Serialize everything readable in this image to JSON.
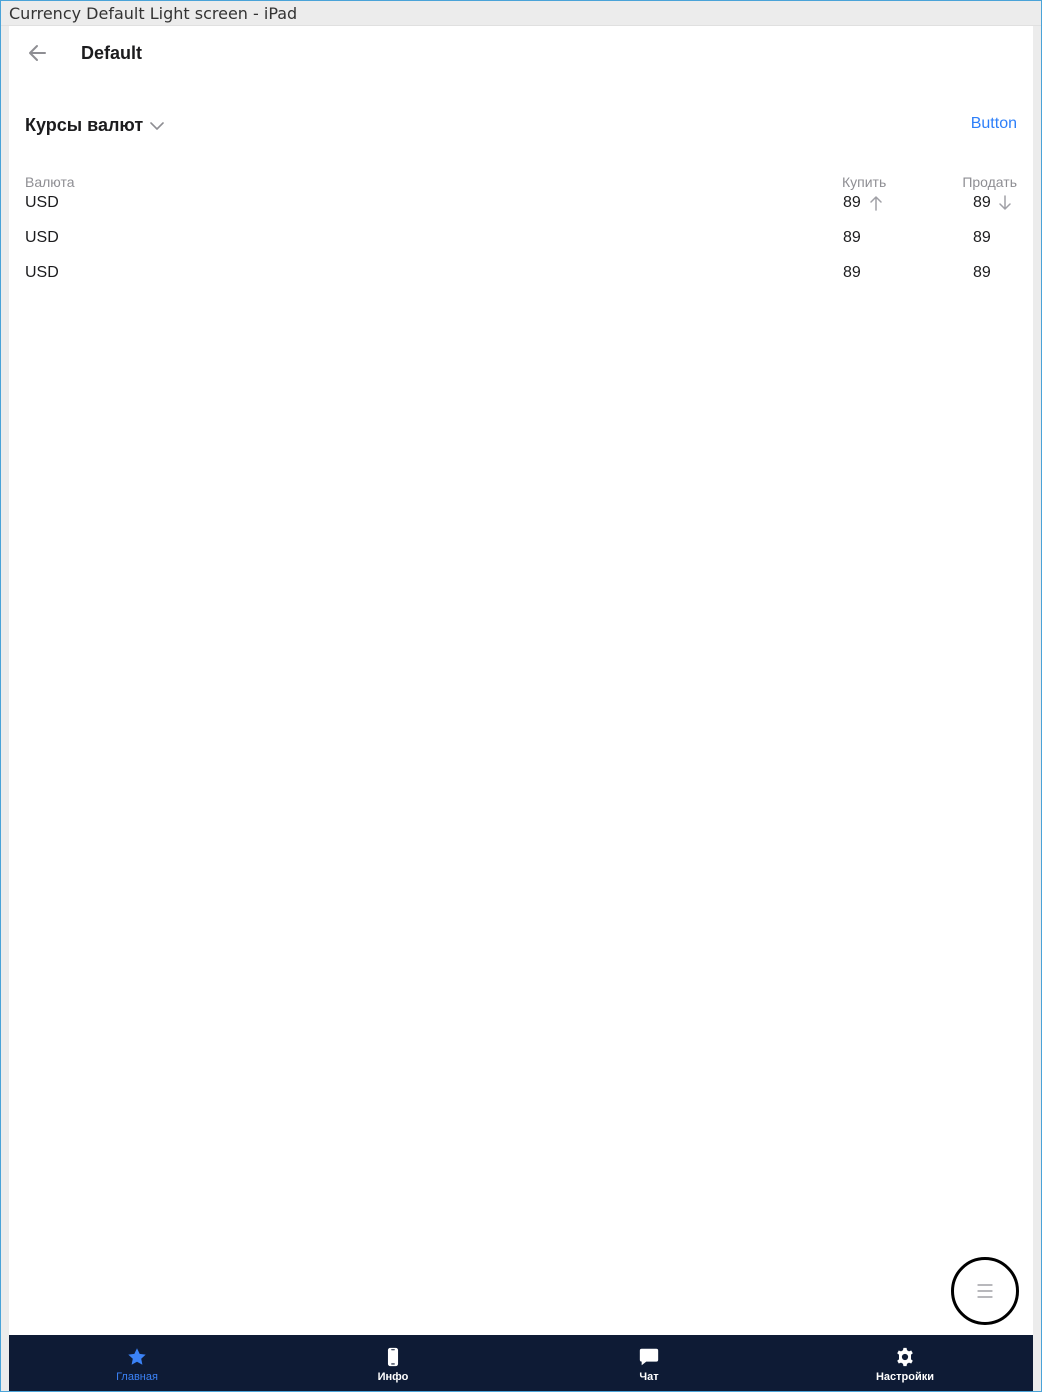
{
  "frame": {
    "title": "Currency Default Light screen - iPad"
  },
  "nav": {
    "title": "Default"
  },
  "section": {
    "title": "Курсы валют",
    "button_label": "Button"
  },
  "table": {
    "headers": {
      "currency": "Валюта",
      "buy": "Купить",
      "sell": "Продать"
    },
    "rows": [
      {
        "currency": "USD",
        "buy": "89",
        "sell": "89",
        "buy_trend": "up",
        "sell_trend": "down"
      },
      {
        "currency": "USD",
        "buy": "89",
        "sell": "89"
      },
      {
        "currency": "USD",
        "buy": "89",
        "sell": "89"
      }
    ]
  },
  "tabbar": {
    "items": [
      {
        "label": "Главная",
        "icon": "star-icon",
        "active": true
      },
      {
        "label": "Инфо",
        "icon": "phone-icon",
        "active": false
      },
      {
        "label": "Чат",
        "icon": "chat-bubble-icon",
        "active": false
      },
      {
        "label": "Настройки",
        "icon": "gear-icon",
        "active": false
      }
    ]
  },
  "colors": {
    "accent": "#2d7ff9",
    "tabbar_bg": "#0e1b35",
    "tab_active": "#3b82f6",
    "secondary_text": "#8e8e93"
  }
}
